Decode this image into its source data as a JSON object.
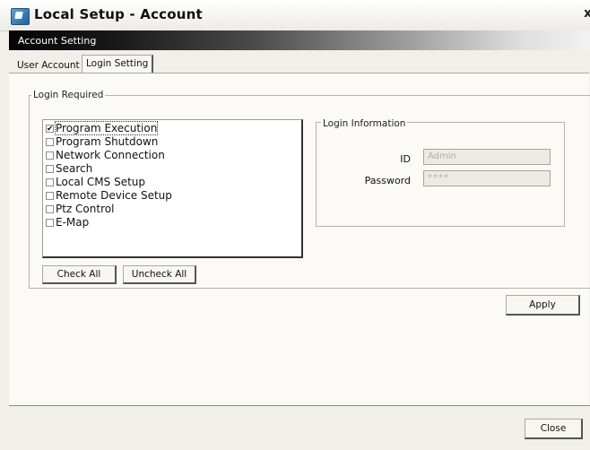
{
  "window": {
    "title": "Local Setup - Account",
    "close_glyph": "x",
    "icon": "app-icon"
  },
  "header": {
    "text": "Account Setting"
  },
  "tabs": [
    {
      "label": "User Account",
      "selected": false
    },
    {
      "label": "Login Setting",
      "selected": true
    }
  ],
  "login_required": {
    "label": "Login Required",
    "items": [
      {
        "label": "Program Execution",
        "checked": true
      },
      {
        "label": "Program Shutdown",
        "checked": false
      },
      {
        "label": "Network Connection",
        "checked": false
      },
      {
        "label": "Search",
        "checked": false
      },
      {
        "label": "Local CMS Setup",
        "checked": false
      },
      {
        "label": "Remote Device Setup",
        "checked": false
      },
      {
        "label": "Ptz Control",
        "checked": false
      },
      {
        "label": "E-Map",
        "checked": false
      }
    ],
    "check_all_label": "Check All",
    "uncheck_all_label": "Uncheck All"
  },
  "login_info": {
    "label": "Login Information",
    "id_label": "ID",
    "id_value": "Admin",
    "password_label": "Password",
    "password_value": "****"
  },
  "apply_label": "Apply",
  "close_label": "Close"
}
